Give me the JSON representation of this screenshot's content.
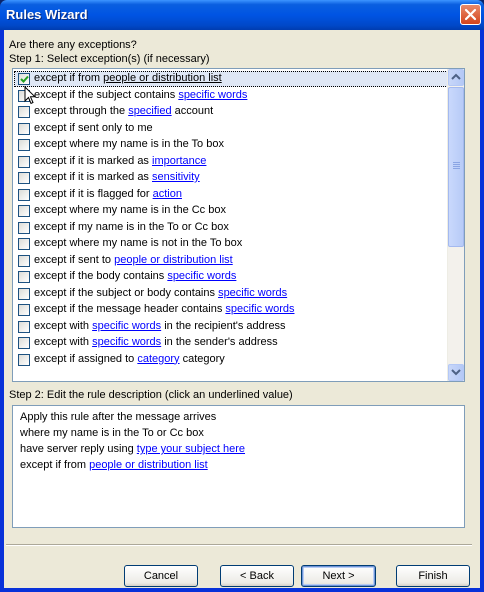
{
  "window": {
    "title": "Rules Wizard"
  },
  "prompt": "Are there any exceptions?",
  "step1_label": "Step 1: Select exception(s) (if necessary)",
  "exceptions": [
    {
      "checked": true,
      "selected": true,
      "pre": "except if from ",
      "link": "people or distribution list",
      "post": "",
      "link_dark": true
    },
    {
      "checked": false,
      "pre": "except if the subject contains ",
      "link": "specific words",
      "post": ""
    },
    {
      "checked": false,
      "pre": "except through the ",
      "link": "specified",
      "post": " account"
    },
    {
      "checked": false,
      "pre": "except if sent only to me",
      "link": "",
      "post": ""
    },
    {
      "checked": false,
      "pre": "except where my name is in the To box",
      "link": "",
      "post": ""
    },
    {
      "checked": false,
      "pre": "except if it is marked as ",
      "link": "importance",
      "post": ""
    },
    {
      "checked": false,
      "pre": "except if it is marked as ",
      "link": "sensitivity",
      "post": ""
    },
    {
      "checked": false,
      "pre": "except if it is flagged for ",
      "link": "action",
      "post": ""
    },
    {
      "checked": false,
      "pre": "except where my name is in the Cc box",
      "link": "",
      "post": ""
    },
    {
      "checked": false,
      "pre": "except if my name is in the To or Cc box",
      "link": "",
      "post": ""
    },
    {
      "checked": false,
      "pre": "except where my name is not in the To box",
      "link": "",
      "post": ""
    },
    {
      "checked": false,
      "pre": "except if sent to ",
      "link": "people or distribution list",
      "post": ""
    },
    {
      "checked": false,
      "pre": "except if the body contains ",
      "link": "specific words",
      "post": ""
    },
    {
      "checked": false,
      "pre": "except if the subject or body contains ",
      "link": "specific words",
      "post": ""
    },
    {
      "checked": false,
      "pre": "except if the message header contains ",
      "link": "specific words",
      "post": ""
    },
    {
      "checked": false,
      "pre": "except with ",
      "link": "specific words",
      "post": " in the recipient's address"
    },
    {
      "checked": false,
      "pre": "except with ",
      "link": "specific words",
      "post": " in the sender's address"
    },
    {
      "checked": false,
      "pre": "except if assigned to ",
      "link": "category",
      "post": " category"
    }
  ],
  "step2_label": "Step 2: Edit the rule description (click an underlined value)",
  "description": [
    {
      "pre": "Apply this rule after the message arrives",
      "link": "",
      "post": ""
    },
    {
      "pre": "where my name is in the To or Cc box",
      "link": "",
      "post": ""
    },
    {
      "pre": "have server reply using ",
      "link": "type your subject here",
      "post": ""
    },
    {
      "pre": "except if from ",
      "link": "people or distribution list",
      "post": ""
    }
  ],
  "buttons": {
    "cancel": "Cancel",
    "back": "< Back",
    "next": "Next >",
    "finish": "Finish"
  },
  "icons": {
    "close": "close-icon",
    "scroll_up": "chevron-up-icon",
    "scroll_down": "chevron-down-icon",
    "checkmark": "checkmark-icon",
    "cursor": "mouse-pointer-icon"
  }
}
